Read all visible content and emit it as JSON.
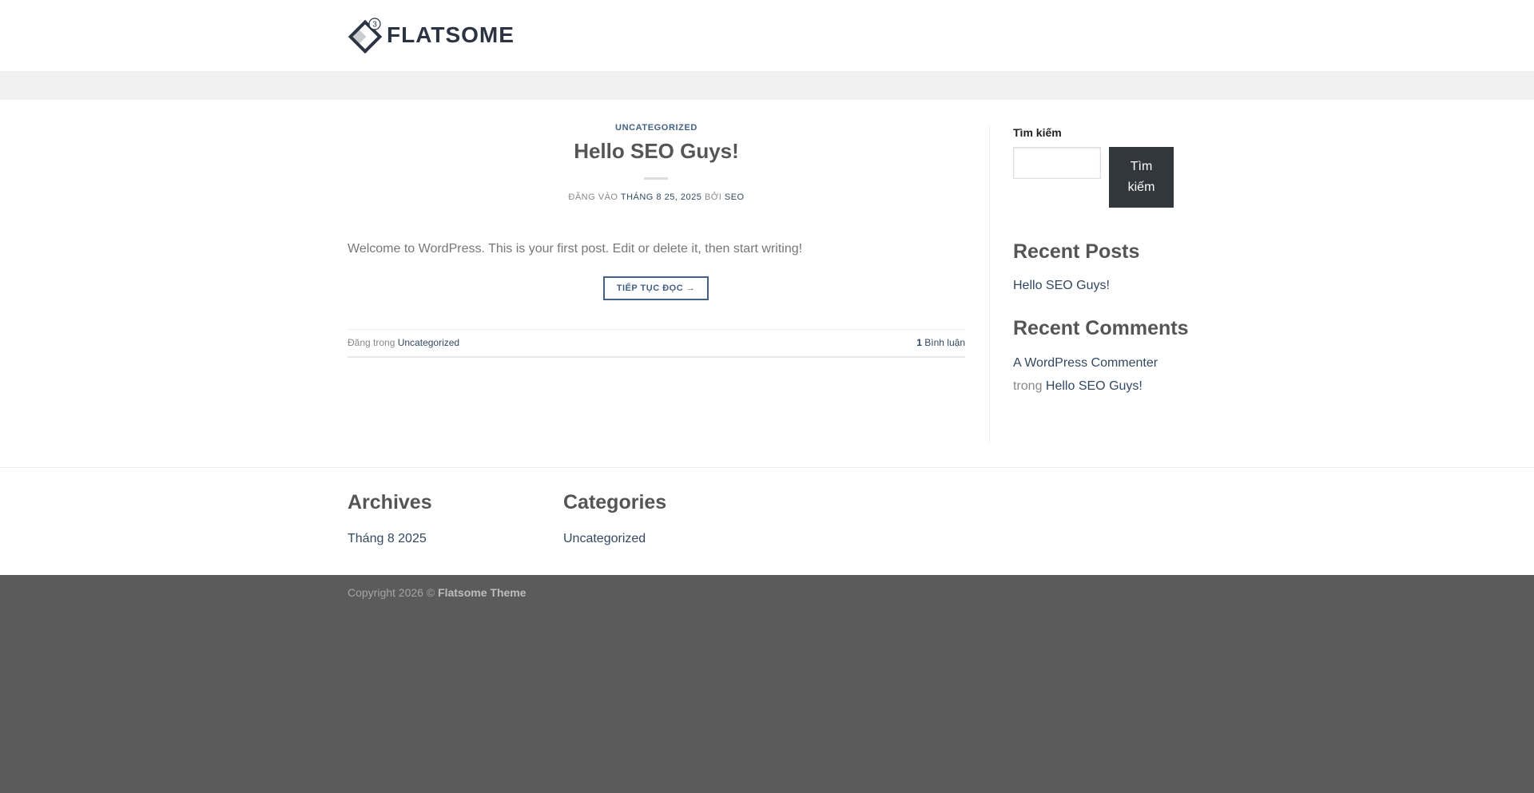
{
  "header": {
    "logo_text": "FLATSOME",
    "logo_badge": "3"
  },
  "post": {
    "category": "UNCATEGORIZED",
    "title": "Hello SEO Guys!",
    "meta_prefix": "ĐĂNG VÀO",
    "meta_date": "THÁNG 8 25, 2025",
    "meta_by": "BỞI",
    "meta_author": "SEO",
    "excerpt": "Welcome to WordPress. This is your first post. Edit or delete it, then start writing!",
    "read_more": "TIẾP TỤC ĐỌC →",
    "footer_prefix": "Đăng trong",
    "footer_category": "Uncategorized",
    "comment_count": "1",
    "comment_label": "Bình luận"
  },
  "sidebar": {
    "search_label": "Tìm kiếm",
    "search_value": "",
    "search_button": "Tìm kiếm",
    "recent_posts_title": "Recent Posts",
    "recent_posts": [
      "Hello SEO Guys!"
    ],
    "recent_comments_title": "Recent Comments",
    "comment_author": "A WordPress Commenter",
    "comment_on": "trong",
    "comment_post": "Hello SEO Guys!"
  },
  "footer": {
    "archives_title": "Archives",
    "archives_item": "Tháng 8 2025",
    "categories_title": "Categories",
    "categories_item": "Uncategorized",
    "copyright_prefix": "Copyright 2026 ©",
    "copyright_name": "Flatsome Theme"
  },
  "colors": {
    "primary": "#446084",
    "link": "#334862",
    "footer_bg": "#5b5b5b",
    "search_button_bg": "#32373c"
  }
}
